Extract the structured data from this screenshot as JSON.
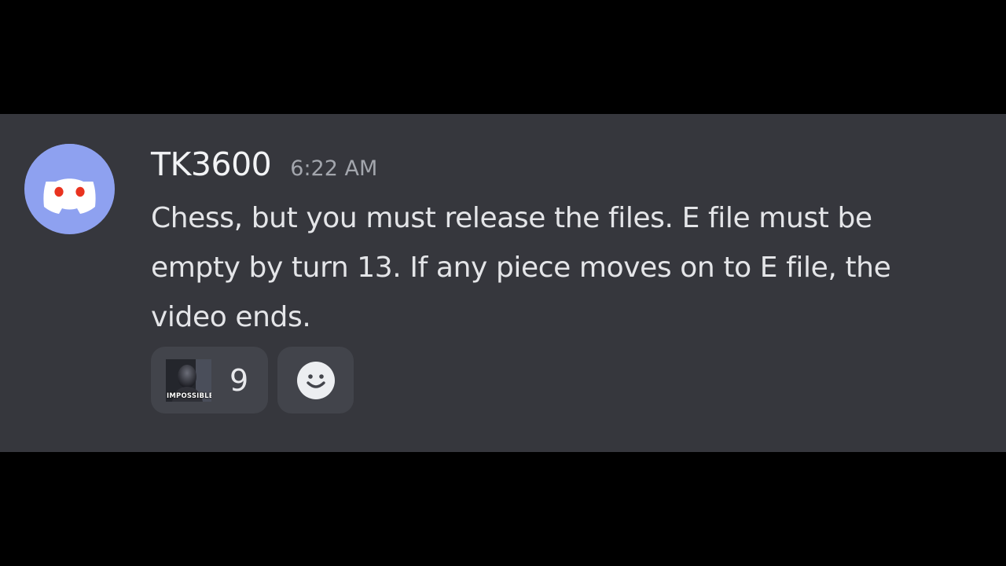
{
  "message": {
    "author": "TK3600",
    "timestamp": "6:22 AM",
    "content": "Chess, but you must release the files. E file must be empty by turn 13. If any piece moves on to E file, the video ends.",
    "avatar_icon": "discord-logo-icon",
    "avatar_color": "#8ea1f0"
  },
  "reactions": [
    {
      "emoji_icon": "impossible-meme-emoji",
      "emoji_caption": "IMPOSSIBLE",
      "count": "9"
    }
  ],
  "add_reaction_icon": "smiley-face-icon",
  "colors": {
    "background": "#000000",
    "message_bg": "#36373d",
    "reaction_bg": "#42444b",
    "username": "#f2f3f5",
    "timestamp": "#a3a6ad",
    "text": "#e4e5e8"
  }
}
